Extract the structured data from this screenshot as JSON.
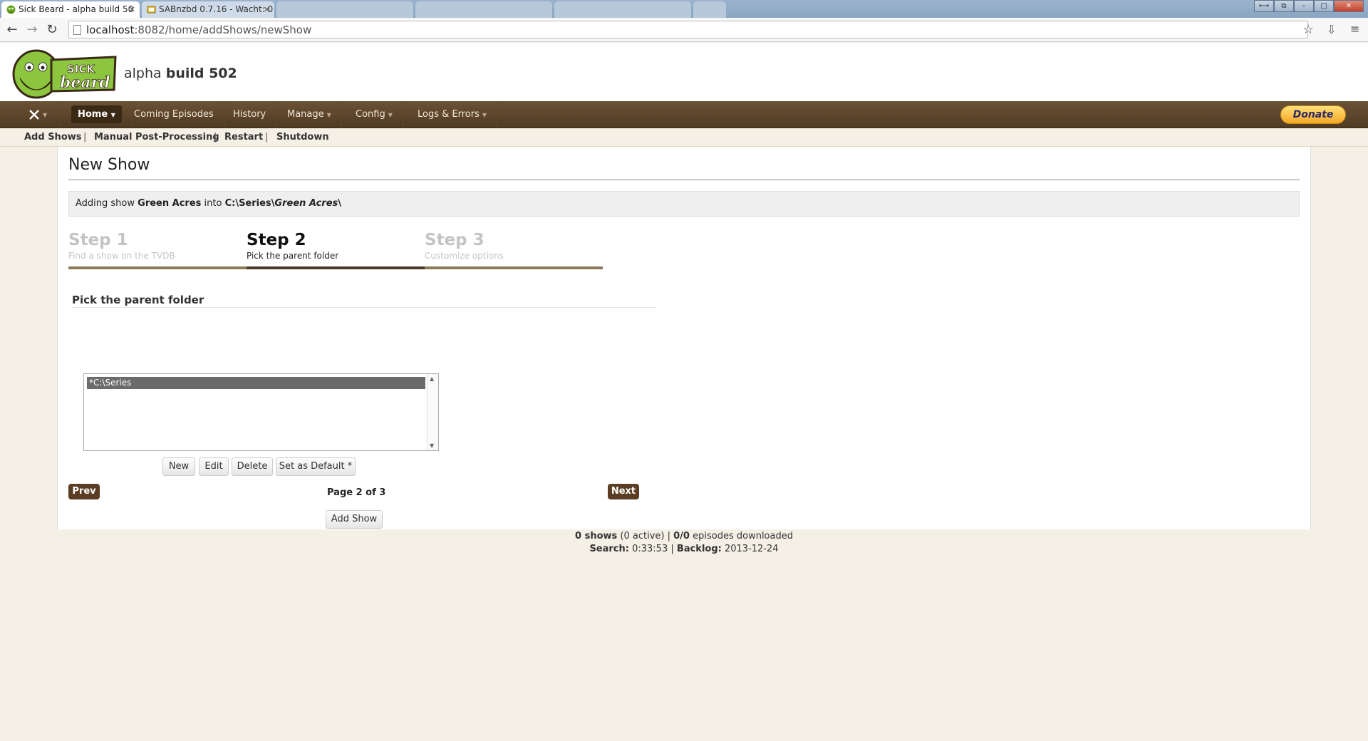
{
  "browser": {
    "tabs": [
      {
        "title": "Sick Beard - alpha build 50",
        "state": "active"
      },
      {
        "title": "SABnzbd 0.7.16 - Wacht: 0",
        "state": "inactive"
      }
    ],
    "url_host": "localhost",
    "url_path": ":8082/home/addShows/newShow"
  },
  "header": {
    "logo_text": "SICK beard",
    "build_prefix": "alpha",
    "build_name": "build 502"
  },
  "nav": {
    "items": [
      {
        "label": "Home"
      },
      {
        "label": "Coming Episodes"
      },
      {
        "label": "History"
      },
      {
        "label": "Manage"
      },
      {
        "label": "Config"
      },
      {
        "label": "Logs & Errors"
      }
    ],
    "donate": "Donate"
  },
  "subnav": {
    "add_shows": "Add Shows",
    "manual_pp": "Manual Post-Processing",
    "restart": "Restart",
    "shutdown": "Shutdown",
    "separator": "|"
  },
  "main": {
    "title": "New Show",
    "info_prefix": "Adding show",
    "show_name": "Green Acres",
    "info_into": "into",
    "path_root": "C:\\Series\\",
    "path_show": "Green Acres",
    "path_tail": "\\",
    "steps": [
      {
        "title": "Step 1",
        "desc": "Find a show on the TVDB"
      },
      {
        "title": "Step 2",
        "desc": "Pick the parent folder"
      },
      {
        "title": "Step 3",
        "desc": "Customize options"
      }
    ],
    "section_title": "Pick the parent folder",
    "folders": [
      "*C:\\Series"
    ],
    "buttons": {
      "new": "New",
      "edit": "Edit",
      "delete": "Delete",
      "set_default": "Set as Default *"
    },
    "prev": "Prev",
    "next": "Next",
    "page_indicator": "Page 2 of 3",
    "add_show": "Add Show"
  },
  "footer": {
    "shows_count": "0 shows",
    "active": "(0 active)",
    "sep": "|",
    "episodes": "0/0",
    "episodes_label": "episodes downloaded",
    "search_label": "Search:",
    "search_value": "0:33:53",
    "backlog_label": "Backlog:",
    "backlog_value": "2013-12-24"
  },
  "colors": {
    "nav_brown": "#5a4129",
    "step_bar_active": "#4a3a28",
    "step_bar_done": "#8c7a5a"
  }
}
